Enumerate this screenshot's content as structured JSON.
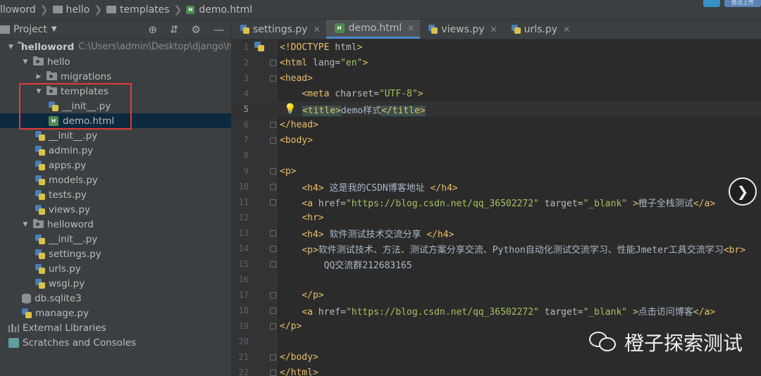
{
  "breadcrumb": [
    "lloword",
    "hello",
    "templates",
    "demo.html"
  ],
  "topright": {
    "badge": "",
    "label": "推送上传"
  },
  "project_panel": {
    "title": "Project",
    "tree": [
      {
        "label": "helloword",
        "path": "C:\\Users\\admin\\Desktop\\django\\hello",
        "type": "folder",
        "level": 0,
        "expanded": true
      },
      {
        "label": "hello",
        "type": "package",
        "level": 1,
        "expanded": true
      },
      {
        "label": "migrations",
        "type": "package",
        "level": 2,
        "expanded": false
      },
      {
        "label": "templates",
        "type": "package",
        "level": 2,
        "expanded": true
      },
      {
        "label": "__init__.py",
        "type": "py",
        "level": 3
      },
      {
        "label": "demo.html",
        "type": "html",
        "level": 3,
        "selected": true
      },
      {
        "label": "__init__.py",
        "type": "py",
        "level": 2
      },
      {
        "label": "admin.py",
        "type": "py",
        "level": 2
      },
      {
        "label": "apps.py",
        "type": "py",
        "level": 2
      },
      {
        "label": "models.py",
        "type": "py",
        "level": 2
      },
      {
        "label": "tests.py",
        "type": "py",
        "level": 2
      },
      {
        "label": "views.py",
        "type": "py",
        "level": 2
      },
      {
        "label": "helloword",
        "type": "package",
        "level": 1,
        "expanded": true
      },
      {
        "label": "__init__.py",
        "type": "py",
        "level": 2
      },
      {
        "label": "settings.py",
        "type": "py",
        "level": 2
      },
      {
        "label": "urls.py",
        "type": "py",
        "level": 2
      },
      {
        "label": "wsgi.py",
        "type": "py",
        "level": 2
      },
      {
        "label": "db.sqlite3",
        "type": "db",
        "level": 1
      },
      {
        "label": "manage.py",
        "type": "py",
        "level": 1
      },
      {
        "label": "External Libraries",
        "type": "lib",
        "level": 0
      },
      {
        "label": "Scratches and Consoles",
        "type": "scratch",
        "level": 0
      }
    ]
  },
  "tabs": [
    {
      "label": "settings.py",
      "type": "py",
      "active": false
    },
    {
      "label": "demo.html",
      "type": "html",
      "active": true
    },
    {
      "label": "views.py",
      "type": "py",
      "active": false
    },
    {
      "label": "urls.py",
      "type": "py",
      "active": false
    }
  ],
  "code_lines": [
    {
      "n": "1",
      "parts": [
        [
          "tag",
          "<!DOCTYPE "
        ],
        [
          "attr",
          "html"
        ],
        [
          "tag",
          ">"
        ]
      ]
    },
    {
      "n": "2",
      "parts": [
        [
          "tag",
          "<html "
        ],
        [
          "attr",
          "lang="
        ],
        [
          "val",
          "\"en\""
        ],
        [
          "tag",
          ">"
        ]
      ]
    },
    {
      "n": "3",
      "parts": [
        [
          "tag",
          "<head>"
        ]
      ]
    },
    {
      "n": "4",
      "parts": [
        [
          "txt",
          "    "
        ],
        [
          "tag",
          "<meta "
        ],
        [
          "attr",
          "charset="
        ],
        [
          "val",
          "\"UTF-8\""
        ],
        [
          "tag",
          ">"
        ]
      ]
    },
    {
      "n": "5",
      "parts": [
        [
          "txt",
          "    "
        ],
        [
          "tag",
          "<title>"
        ],
        [
          "txt",
          "demo样式"
        ],
        [
          "tag",
          "</title>"
        ]
      ],
      "current": true
    },
    {
      "n": "6",
      "parts": [
        [
          "tag",
          "</head>"
        ]
      ]
    },
    {
      "n": "7",
      "parts": [
        [
          "tag",
          "<body>"
        ]
      ]
    },
    {
      "n": "8",
      "parts": []
    },
    {
      "n": "9",
      "parts": [
        [
          "tag",
          "<p>"
        ]
      ]
    },
    {
      "n": "10",
      "parts": [
        [
          "txt",
          "    "
        ],
        [
          "tag",
          "<h4>"
        ],
        [
          "txt",
          " 这是我的CSDN博客地址 "
        ],
        [
          "tag",
          "</h4>"
        ]
      ]
    },
    {
      "n": "11",
      "parts": [
        [
          "txt",
          "    "
        ],
        [
          "tag",
          "<a "
        ],
        [
          "attr",
          "href="
        ],
        [
          "val",
          "\"https://blog.csdn.net/qq_36502272\""
        ],
        [
          "txt",
          " "
        ],
        [
          "attr",
          "target="
        ],
        [
          "val",
          "\"_blank\""
        ],
        [
          "txt",
          " "
        ],
        [
          "tag",
          ">"
        ],
        [
          "txt",
          "橙子全栈测试"
        ],
        [
          "tag",
          "</a>"
        ]
      ]
    },
    {
      "n": "12",
      "parts": [
        [
          "txt",
          "    "
        ],
        [
          "tag",
          "<hr>"
        ]
      ]
    },
    {
      "n": "13",
      "parts": [
        [
          "txt",
          "    "
        ],
        [
          "tag",
          "<h4>"
        ],
        [
          "txt",
          " 软件测试技术交流分享 "
        ],
        [
          "tag",
          "</h4>"
        ]
      ]
    },
    {
      "n": "14",
      "parts": [
        [
          "txt",
          "    "
        ],
        [
          "tag",
          "<p>"
        ],
        [
          "txt",
          "软件测试技术、方法、测试方案分享交流、Python自动化测试交流学习、性能Jmeter工具交流学习"
        ],
        [
          "tag",
          "<br>"
        ]
      ]
    },
    {
      "n": "15",
      "parts": [
        [
          "txt",
          "        QQ交流群212683165"
        ]
      ]
    },
    {
      "n": "16",
      "parts": []
    },
    {
      "n": "17",
      "parts": [
        [
          "txt",
          "    "
        ],
        [
          "tag",
          "</p>"
        ]
      ]
    },
    {
      "n": "18",
      "parts": [
        [
          "txt",
          "    "
        ],
        [
          "tag",
          "<a "
        ],
        [
          "attr",
          "href="
        ],
        [
          "val",
          "\"https://blog.csdn.net/qq_36502272\""
        ],
        [
          "txt",
          " "
        ],
        [
          "attr",
          "target="
        ],
        [
          "val",
          "\"_blank\""
        ],
        [
          "txt",
          " "
        ],
        [
          "tag",
          ">"
        ],
        [
          "txt",
          "点击访问博客"
        ],
        [
          "tag",
          "</a>"
        ]
      ]
    },
    {
      "n": "19",
      "parts": [
        [
          "tag",
          "</p>"
        ]
      ]
    },
    {
      "n": "20",
      "parts": []
    },
    {
      "n": "21",
      "parts": [
        [
          "tag",
          "</body>"
        ]
      ]
    },
    {
      "n": "22",
      "parts": [
        [
          "tag",
          "</html>"
        ]
      ]
    }
  ],
  "watermark": "橙子探索测试",
  "next_button": "❯",
  "colors": {
    "tag": "#e8bf6a",
    "attr": "#bababa",
    "value": "#a5c25c",
    "text": "#a9b7c6",
    "selection": "#0d293e",
    "highlight_box": "#e23a3a"
  }
}
